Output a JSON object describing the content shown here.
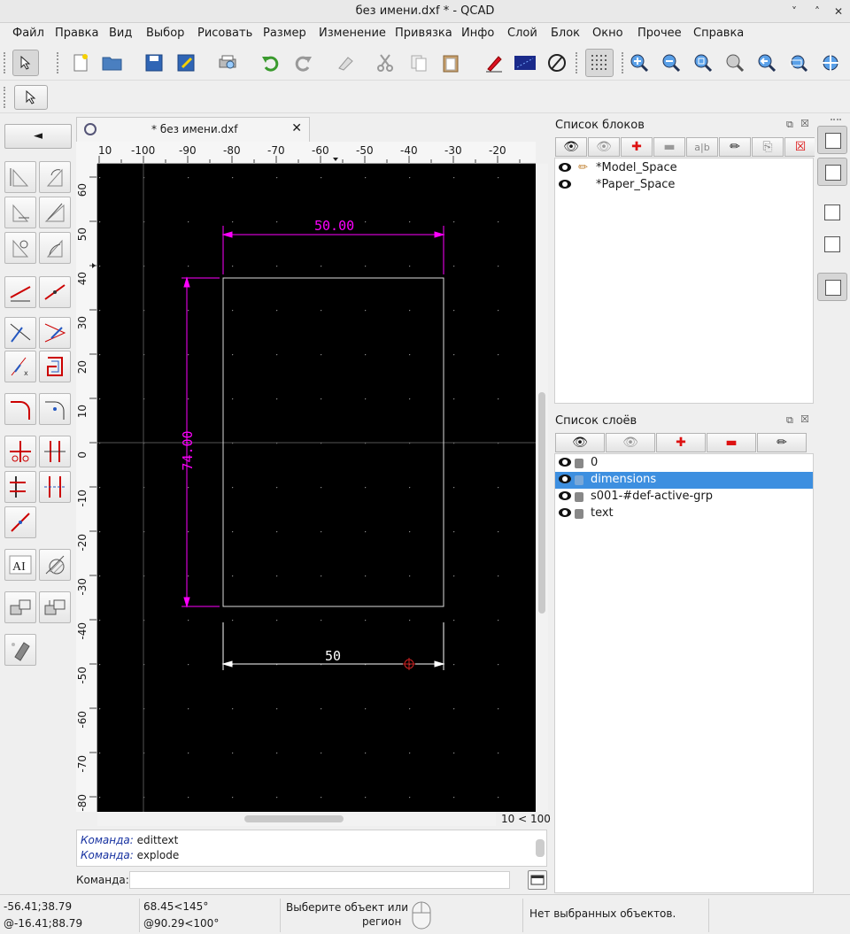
{
  "window": {
    "title": "без имени.dxf * - QCAD",
    "minimize": "˅",
    "maximize": "˄",
    "close": "✕"
  },
  "menu": [
    "Файл",
    "Правка",
    "Вид",
    "Выбор",
    "Рисовать",
    "Размер",
    "Изменение",
    "Привязка",
    "Инфо",
    "Слой",
    "Блок",
    "Окно",
    "Прочее",
    "Справка"
  ],
  "toolbar": {
    "icons": [
      "select-pointer-icon",
      "new-file-icon",
      "open-file-icon",
      "save-icon",
      "save-as-icon",
      "print-preview-icon",
      "undo-icon",
      "redo-icon",
      "eraser-icon",
      "cut-icon",
      "copy-icon",
      "paste-icon",
      "pen-icon",
      "draft-mode-icon",
      "no-entry-icon",
      "grid-icon",
      "zoom-in-icon",
      "zoom-out-icon",
      "zoom-auto-icon",
      "zoom-pan-icon",
      "zoom-previous-icon",
      "zoom-window-icon",
      "zoom-redraw-icon"
    ]
  },
  "left_panel": {
    "back_label": "◄"
  },
  "document": {
    "tab_title": "* без имени.dxf",
    "close": "✕"
  },
  "rulers": {
    "horizontal": [
      "10",
      "-100",
      "-90",
      "-80",
      "-70",
      "-60",
      "-50",
      "-40",
      "-30",
      "-20"
    ],
    "vertical": [
      "60",
      "50",
      "40",
      "30",
      "20",
      "10",
      "0",
      "-10",
      "-20",
      "-30",
      "-40",
      "-50",
      "-60",
      "-70",
      "-80"
    ]
  },
  "drawing": {
    "top_dimension": "50.00",
    "left_dimension": "74.00",
    "bottom_dimension": "50",
    "colors": {
      "dimension": "#ff00ff",
      "geometry": "#ffffff",
      "background": "#000000",
      "marker": "#cc2222"
    }
  },
  "grid_info": "10 < 100",
  "command": {
    "history": [
      {
        "key": "Команда:",
        "value": "edittext"
      },
      {
        "key": "Команда:",
        "value": "explode"
      }
    ],
    "prompt_label": "Команда:",
    "input_value": ""
  },
  "block_list": {
    "title": "Список блоков",
    "items": [
      "*Model_Space",
      "*Paper_Space"
    ]
  },
  "layer_list": {
    "title": "Список слоёв",
    "items": [
      "0",
      "dimensions",
      "s001-#def-active-grp",
      "text"
    ],
    "selected": "dimensions"
  },
  "status": {
    "abs_coord": "-56.41;38.79",
    "rel_coord": "@-16.41;88.79",
    "polar_coord": "68.45<145°",
    "rel_polar": "@90.29<100°",
    "prompt_line1": "Выберите объект или",
    "prompt_line2": "регион",
    "selection": "Нет выбранных объектов."
  }
}
